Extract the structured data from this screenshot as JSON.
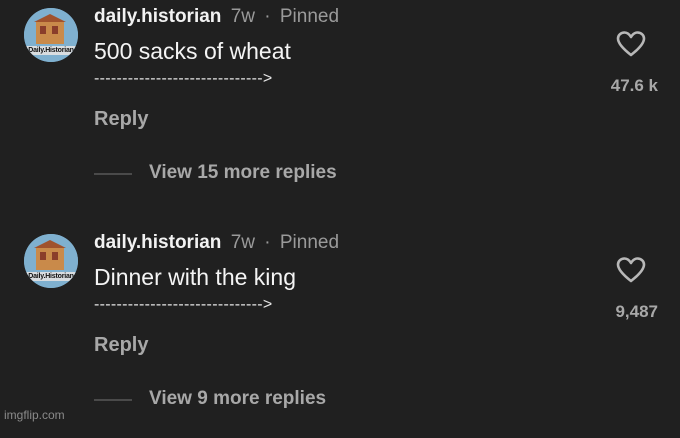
{
  "comments": [
    {
      "avatar_label": "Daily.Historian",
      "username": "daily.historian",
      "age": "7w",
      "separator": "·",
      "pinned": "Pinned",
      "text": "500 sacks of wheat",
      "arrow": "------------------------------>",
      "reply_label": "Reply",
      "view_replies": "View 15 more replies",
      "likes": "47.6 k"
    },
    {
      "avatar_label": "Daily.Historian",
      "username": "daily.historian",
      "age": "7w",
      "separator": "·",
      "pinned": "Pinned",
      "text": "Dinner with the king",
      "arrow": "------------------------------>",
      "reply_label": "Reply",
      "view_replies": "View 9 more replies",
      "likes": "9,487"
    }
  ],
  "icons": {
    "like": "heart-outline-icon"
  },
  "colors": {
    "background": "#202020",
    "muted_text": "#a8a8a8",
    "meta_text": "#9a9a9a"
  },
  "watermark": "imgflip.com"
}
